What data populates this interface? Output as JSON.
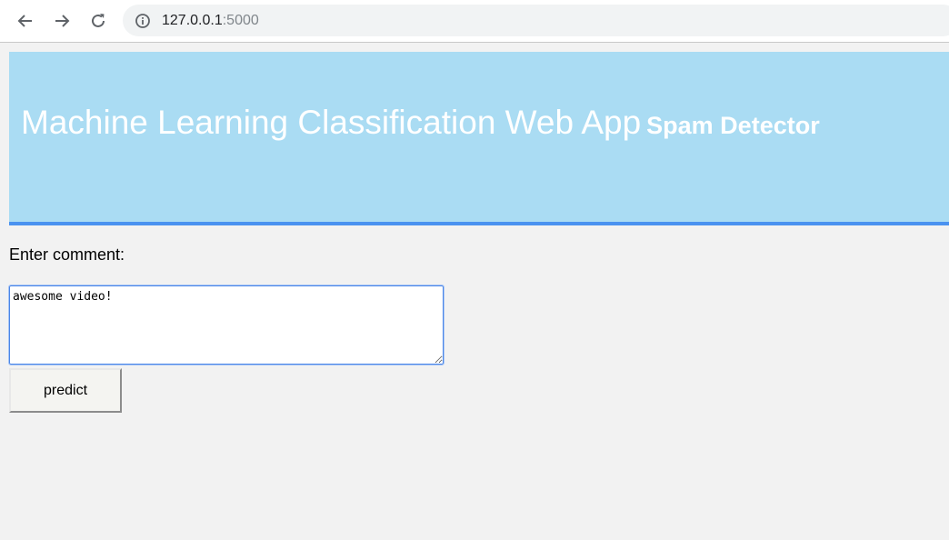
{
  "browser": {
    "url_host": "127.0.0.1",
    "url_port": ":5000"
  },
  "header": {
    "title": "Machine Learning Classification Web App",
    "subtitle": "Spam Detector"
  },
  "form": {
    "label": "Enter comment:",
    "comment_value": "awesome video!",
    "submit_label": "predict"
  },
  "colors": {
    "header_bg": "#aadcf3",
    "header_border": "#4a92f0",
    "page_bg": "#f2f2f2"
  },
  "icons": [
    "back-arrow-icon",
    "forward-arrow-icon",
    "reload-icon",
    "info-icon"
  ]
}
